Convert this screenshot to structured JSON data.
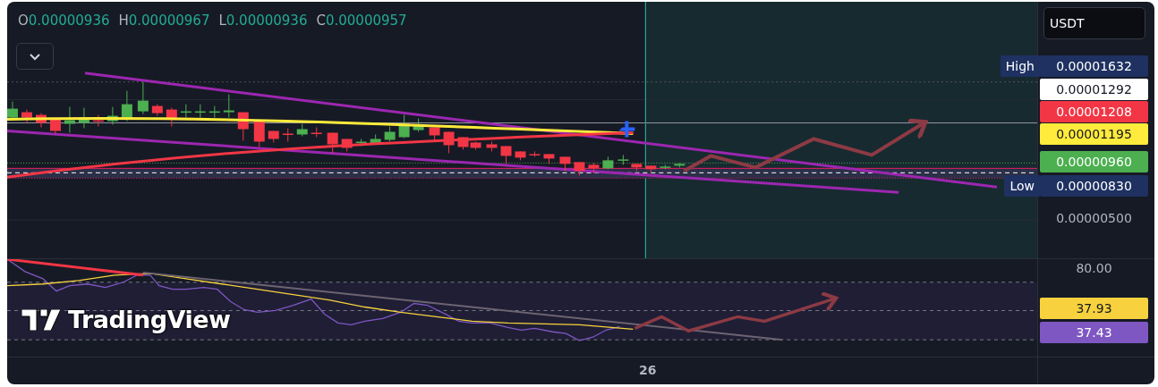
{
  "legend": [
    {
      "key": "O",
      "value": "0.00000936"
    },
    {
      "key": "H",
      "value": "0.00000967"
    },
    {
      "key": "L",
      "value": "0.00000936"
    },
    {
      "key": "C",
      "value": "0.00000957"
    }
  ],
  "currency": "USDT",
  "price_axis": [
    {
      "text": "0.00001632",
      "tag": "High",
      "color": "#1e3161"
    },
    {
      "text": "0.00001292",
      "color": "#ffffff"
    },
    {
      "text": "0.00001208",
      "color": "#f23645"
    },
    {
      "text": "0.00001195",
      "color": "#ffeb3b"
    },
    {
      "text": "0.00000960",
      "color": "#4caf50"
    },
    {
      "text": "0.00000830",
      "tag": "Low",
      "color": "#1e3161"
    },
    {
      "text": "0.00000500"
    }
  ],
  "indicator_axis": [
    {
      "text": "80.00"
    },
    {
      "text": "37.93",
      "color": "#f7d23e"
    },
    {
      "text": "37.43",
      "color": "#7e57c2"
    }
  ],
  "time_axis": [
    "26"
  ],
  "logo": "TradingView"
}
